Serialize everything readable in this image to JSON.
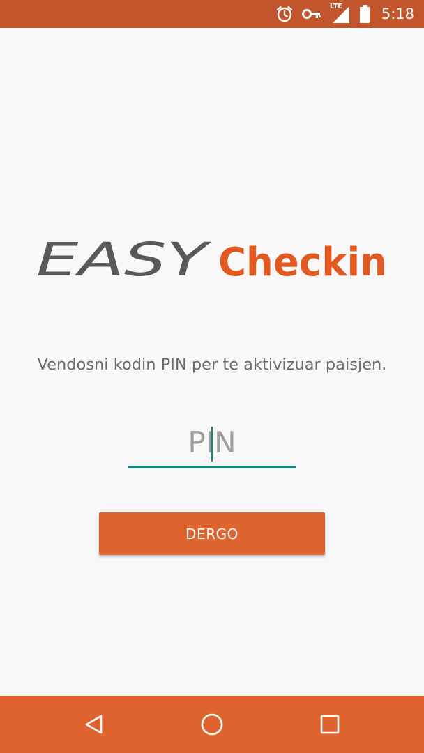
{
  "status_bar": {
    "time": "5:18",
    "network_label": "LTE",
    "icons": [
      "alarm-icon",
      "vpn-key-icon",
      "signal-icon",
      "battery-icon"
    ],
    "color": "#c2552b"
  },
  "logo": {
    "part1": "EASY",
    "part2": "Checkin",
    "part1_color": "#58595b",
    "part2_color": "#e05a22"
  },
  "instruction": "Vendosni kodin PIN per te aktivizuar paisjen.",
  "pin_field": {
    "value": "",
    "placeholder": "PIN",
    "accent": "#0f8a7e"
  },
  "submit_button": {
    "label": "DERGO",
    "color": "#e06430"
  },
  "nav_bar": {
    "icons": [
      "back-icon",
      "home-icon",
      "recents-icon"
    ],
    "color": "#e06430"
  }
}
